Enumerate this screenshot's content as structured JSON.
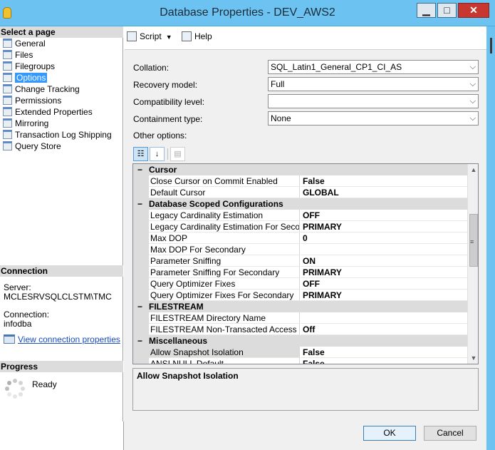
{
  "window": {
    "title": "Database Properties - DEV_AWS2",
    "controls": {
      "minimize": "▁",
      "maximize": "□",
      "close": "✕"
    }
  },
  "left": {
    "select_page_header": "Select a page",
    "pages": [
      {
        "label": "General"
      },
      {
        "label": "Files"
      },
      {
        "label": "Filegroups"
      },
      {
        "label": "Options",
        "selected": true
      },
      {
        "label": "Change Tracking"
      },
      {
        "label": "Permissions"
      },
      {
        "label": "Extended Properties"
      },
      {
        "label": "Mirroring"
      },
      {
        "label": "Transaction Log Shipping"
      },
      {
        "label": "Query Store"
      }
    ],
    "connection_header": "Connection",
    "server_label": "Server:",
    "server_value": "MCLESRVSQLCLSTM\\TMC",
    "connection_label": "Connection:",
    "connection_value": "infodba",
    "view_connection_link": "View connection properties",
    "progress_header": "Progress",
    "progress_status": "Ready"
  },
  "toolbar": {
    "script_label": "Script",
    "help_label": "Help"
  },
  "form": {
    "collation_label": "Collation:",
    "collation_value": "SQL_Latin1_General_CP1_CI_AS",
    "recovery_label": "Recovery model:",
    "recovery_value": "Full",
    "compat_label": "Compatibility level:",
    "compat_value": "",
    "containment_label": "Containment type:",
    "containment_value": "None",
    "other_options_label": "Other options:"
  },
  "grid": {
    "rows": [
      {
        "kind": "category",
        "name": "Cursor"
      },
      {
        "kind": "prop",
        "name": "Close Cursor on Commit Enabled",
        "value": "False"
      },
      {
        "kind": "prop",
        "name": "Default Cursor",
        "value": "GLOBAL"
      },
      {
        "kind": "category",
        "name": "Database Scoped Configurations"
      },
      {
        "kind": "prop",
        "name": "Legacy Cardinality Estimation",
        "value": "OFF"
      },
      {
        "kind": "prop",
        "name": "Legacy Cardinality Estimation For Secondary",
        "value": "PRIMARY"
      },
      {
        "kind": "prop",
        "name": "Max DOP",
        "value": "0"
      },
      {
        "kind": "prop",
        "name": "Max DOP For Secondary",
        "value": ""
      },
      {
        "kind": "prop",
        "name": "Parameter Sniffing",
        "value": "ON"
      },
      {
        "kind": "prop",
        "name": "Parameter Sniffing For Secondary",
        "value": "PRIMARY"
      },
      {
        "kind": "prop",
        "name": "Query Optimizer Fixes",
        "value": "OFF"
      },
      {
        "kind": "prop",
        "name": "Query Optimizer Fixes For Secondary",
        "value": "PRIMARY"
      },
      {
        "kind": "category",
        "name": "FILESTREAM"
      },
      {
        "kind": "prop",
        "name": "FILESTREAM Directory Name",
        "value": ""
      },
      {
        "kind": "prop",
        "name": "FILESTREAM Non-Transacted Access",
        "value": "Off"
      },
      {
        "kind": "category",
        "name": "Miscellaneous"
      },
      {
        "kind": "prop",
        "name": "Allow Snapshot Isolation",
        "value": "False",
        "selected": true
      },
      {
        "kind": "prop",
        "name": "ANSI NULL Default",
        "value": "False"
      }
    ],
    "description": "Allow Snapshot Isolation"
  },
  "buttons": {
    "ok": "OK",
    "cancel": "Cancel"
  },
  "colors": {
    "titlebar": "#6cc3f2",
    "selection": "#3399ff",
    "link": "#1a4dbd"
  }
}
